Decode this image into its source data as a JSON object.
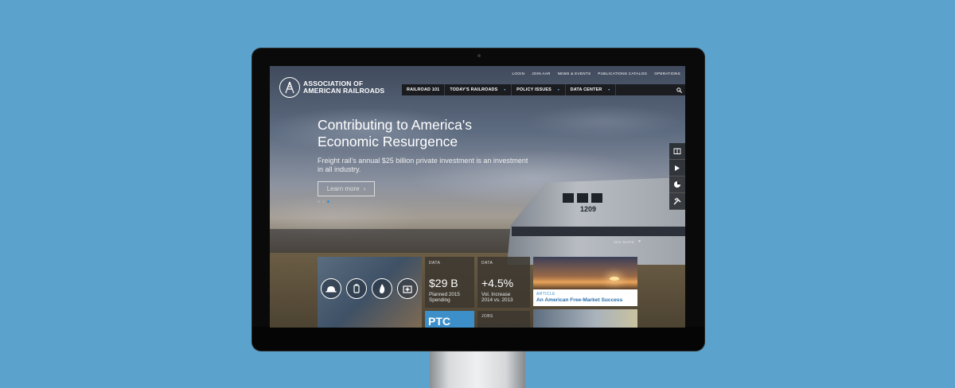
{
  "colors": {
    "background": "#5ba3cd",
    "accent": "#3d8fc9",
    "nav_bar": "#1a1c20"
  },
  "logo": {
    "line1": "ASSOCIATION OF",
    "line2": "AMERICAN RAILROADS"
  },
  "utility_nav": [
    "LOGIN",
    "JOIN AAR",
    "NEWS & EVENTS",
    "PUBLICATIONS CATALOG",
    "OPERATIONS"
  ],
  "main_nav": {
    "items": [
      "RAILROAD 101",
      "TODAY'S RAILROADS",
      "POLICY ISSUES",
      "DATA CENTER"
    ],
    "search_icon": "search-icon"
  },
  "hero": {
    "title": "Contributing to America's Economic Resurgence",
    "subtitle": "Freight rail's annual $25 billion private investment is an investment in all industry.",
    "button_label": "Learn more",
    "see_more": "SEE MORE",
    "locomotive_number": "1209"
  },
  "side_tools": [
    "book-icon",
    "play-icon",
    "pie-chart-icon",
    "tools-icon"
  ],
  "tiles": {
    "data1": {
      "label": "DATA",
      "value": "$29 B",
      "desc_line1": "Planned 2015",
      "desc_line2": "Spending"
    },
    "data2": {
      "label": "DATA",
      "value": "+4.5%",
      "desc_line1": "Vol. Increase",
      "desc_line2": "2014 vs. 2013"
    },
    "ptc": {
      "text": "PTC"
    },
    "jobs": {
      "label": "JOBS"
    },
    "article": {
      "kicker": "ARTICLE",
      "title": "An American Free-Market Success"
    },
    "photo_icons": [
      "helmet-icon",
      "lantern-icon",
      "flame-icon",
      "hospital-icon"
    ]
  }
}
